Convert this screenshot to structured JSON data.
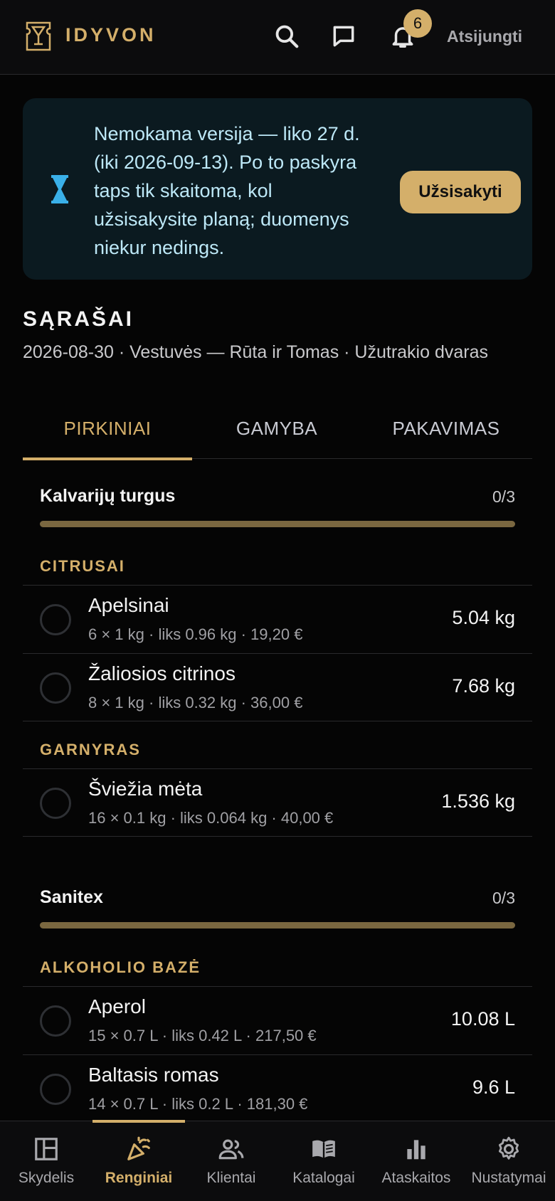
{
  "header": {
    "brand": "IDYVON",
    "notification_count": "6",
    "logout_label": "Atsijungti",
    "accent_color": "#d4af6a"
  },
  "banner": {
    "text": "Nemokama versija — liko 27 d. (iki 2026-09-13). Po to paskyra taps tik skaitoma, kol užsisakysite planą; duomenys niekur nedings.",
    "button_label": "Užsisakyti"
  },
  "page": {
    "title": "SĄRAŠAI",
    "subtitle": "2026-08-30 · Vestuvės — Rūta ir Tomas · Užutrakio dvaras"
  },
  "tabs": [
    {
      "label": "PIRKINIAI",
      "active": true
    },
    {
      "label": "GAMYBA",
      "active": false
    },
    {
      "label": "PAKAVIMAS",
      "active": false
    }
  ],
  "vendors": [
    {
      "name": "Kalvarijų turgus",
      "count": "0/3",
      "progress": 0,
      "categories": [
        {
          "name": "CITRUSAI",
          "items": [
            {
              "name": "Apelsinai",
              "meta": "6 × 1 kg · liks 0.96 kg · 19,20 €",
              "qty": "5.04 kg"
            },
            {
              "name": "Žaliosios citrinos",
              "meta": "8 × 1 kg · liks 0.32 kg · 36,00 €",
              "qty": "7.68 kg"
            }
          ]
        },
        {
          "name": "GARNYRAS",
          "items": [
            {
              "name": "Šviežia mėta",
              "meta": "16 × 0.1 kg · liks 0.064 kg · 40,00 €",
              "qty": "1.536 kg"
            }
          ]
        }
      ]
    },
    {
      "name": "Sanitex",
      "count": "0/3",
      "progress": 0,
      "categories": [
        {
          "name": "ALKOHOLIO BAZĖ",
          "items": [
            {
              "name": "Aperol",
              "meta": "15 × 0.7 L · liks 0.42 L · 217,50 €",
              "qty": "10.08 L"
            },
            {
              "name": "Baltasis romas",
              "meta": "14 × 0.7 L · liks 0.2 L · 181,30 €",
              "qty": "9.6 L"
            }
          ]
        }
      ]
    }
  ],
  "nav": [
    {
      "label": "Skydelis",
      "icon": "dashboard-icon",
      "active": false
    },
    {
      "label": "Renginiai",
      "icon": "party-icon",
      "active": true
    },
    {
      "label": "Klientai",
      "icon": "people-icon",
      "active": false
    },
    {
      "label": "Katalogai",
      "icon": "book-icon",
      "active": false
    },
    {
      "label": "Ataskaitos",
      "icon": "bar-chart-icon",
      "active": false
    },
    {
      "label": "Nustatymai",
      "icon": "gear-icon",
      "active": false
    }
  ]
}
